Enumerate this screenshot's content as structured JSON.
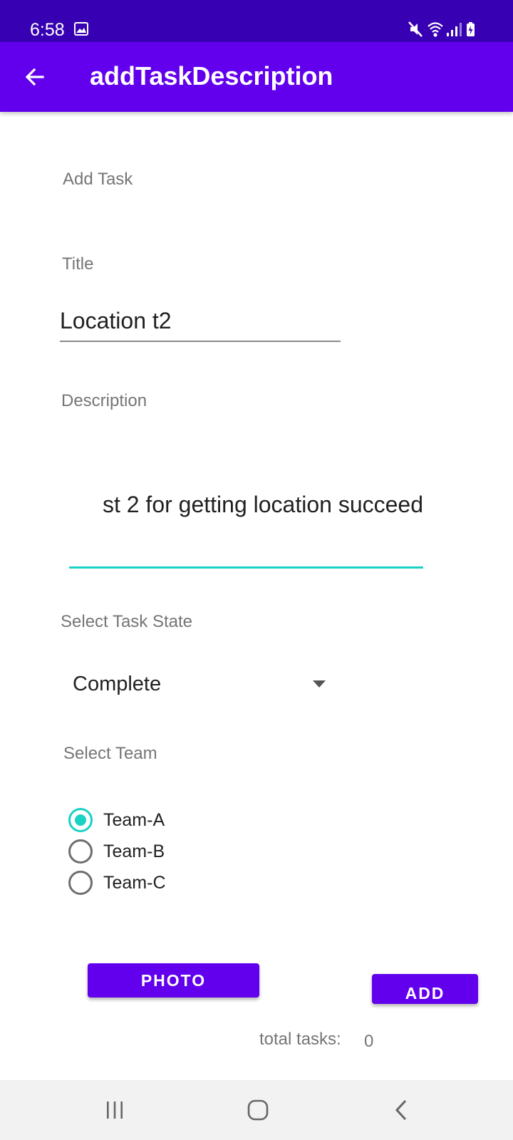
{
  "status_bar": {
    "time": "6:58",
    "icons": [
      "gallery-icon",
      "mute-icon",
      "wifi-icon",
      "signal-icon",
      "battery-charging-icon"
    ]
  },
  "app_bar": {
    "title": "addTaskDescription",
    "back_icon": "arrow-left-icon",
    "color": "#6200ee"
  },
  "form": {
    "heading": "Add Task",
    "title_label": "Title",
    "title_value": "Location t2",
    "description_label": "Description",
    "description_value": "st 2 for getting location succeed",
    "task_state_label": "Select Task State",
    "task_state_value": "Complete",
    "team_label": "Select Team",
    "teams": [
      {
        "label": "Team-A",
        "selected": true
      },
      {
        "label": "Team-B",
        "selected": false
      },
      {
        "label": "Team-C",
        "selected": false
      }
    ]
  },
  "buttons": {
    "photo_label": "PHOTO",
    "add_label": "ADD"
  },
  "footer": {
    "total_label": "total tasks:",
    "total_value": "0"
  },
  "nav_bar": {
    "icons": [
      "recent-apps-icon",
      "home-icon",
      "back-icon"
    ]
  },
  "colors": {
    "status_bar": "#3700b3",
    "primary": "#6200ee",
    "accent": "#1ad2c4",
    "label_text": "#757575"
  }
}
